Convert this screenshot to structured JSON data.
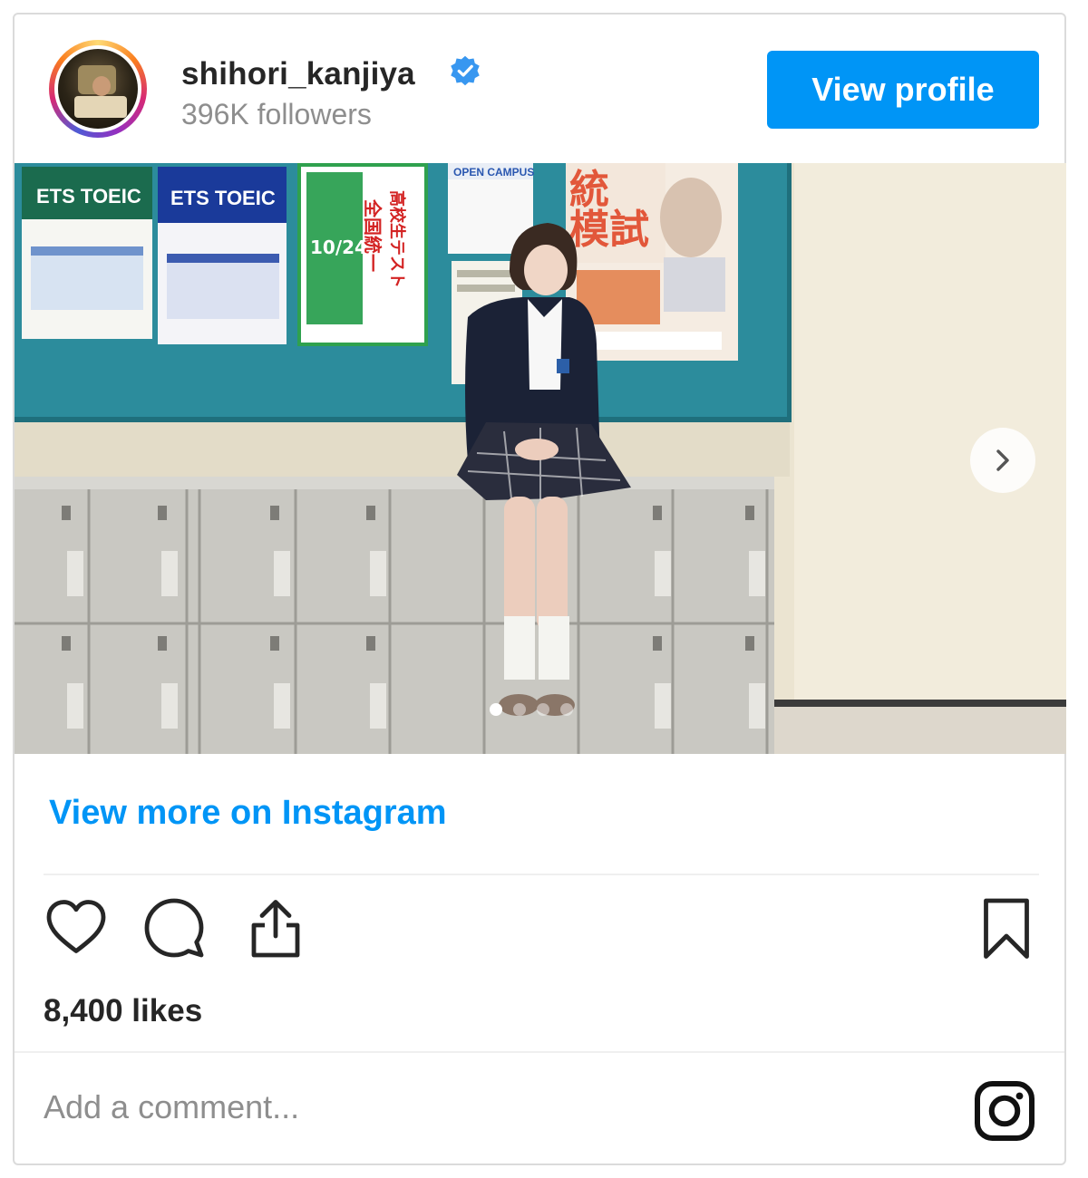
{
  "header": {
    "username": "shihori_kanjiya",
    "followers": "396K followers",
    "view_profile_label": "View profile"
  },
  "photo": {
    "poster_texts": [
      "ETS TOEIC",
      "ETS TOEIC",
      "全国統一",
      "高校生テスト",
      "10/24",
      "OPEN CAMPUS",
      "統",
      "模試"
    ]
  },
  "view_more_label": "View more on Instagram",
  "likes": "8,400 likes",
  "comment": {
    "placeholder": "Add a comment..."
  },
  "colors": {
    "accent": "#0095f6",
    "text": "#262626",
    "muted": "#8e8e8e",
    "verified": "#3897f0"
  },
  "icons": [
    "verified-badge-icon",
    "heart-icon",
    "comment-icon",
    "share-icon",
    "bookmark-icon",
    "instagram-logo-icon",
    "chevron-right-icon"
  ]
}
